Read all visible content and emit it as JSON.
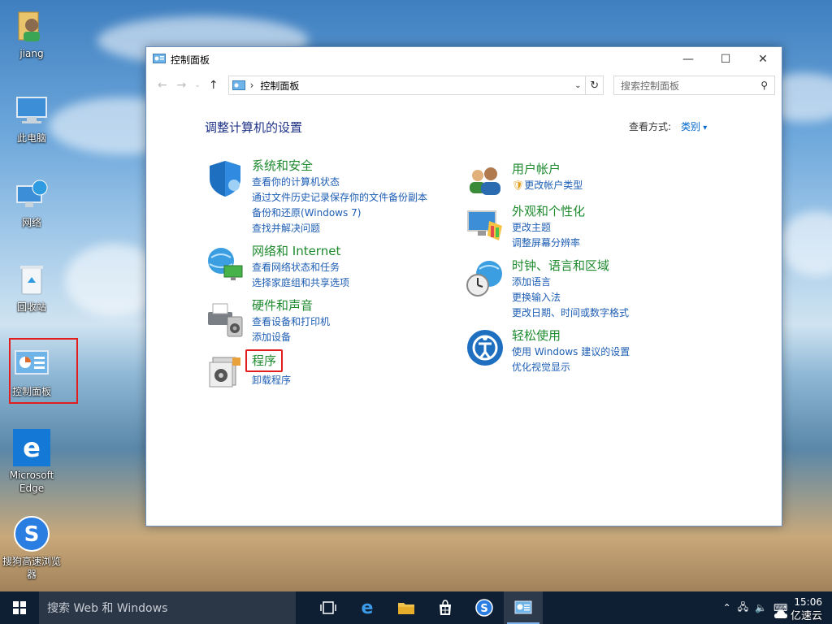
{
  "desktop": {
    "icons": [
      {
        "label": "jiang"
      },
      {
        "label": "此电脑"
      },
      {
        "label": "网络"
      },
      {
        "label": "回收站"
      },
      {
        "label": "控制面板"
      },
      {
        "label": "Microsoft Edge"
      },
      {
        "label": "搜狗高速浏览器"
      }
    ]
  },
  "window": {
    "title": "控制面板",
    "address": {
      "crumb": "控制面板",
      "separator": "›"
    },
    "search_placeholder": "搜索控制面板",
    "heading": "调整计算机的设置",
    "view_by_label": "查看方式:",
    "view_by_value": "类别",
    "categories_left": [
      {
        "title": "系统和安全",
        "links": [
          "查看你的计算机状态",
          "通过文件历史记录保存你的文件备份副本",
          "备份和还原(Windows 7)",
          "查找并解决问题"
        ]
      },
      {
        "title": "网络和 Internet",
        "links": [
          "查看网络状态和任务",
          "选择家庭组和共享选项"
        ]
      },
      {
        "title": "硬件和声音",
        "links": [
          "查看设备和打印机",
          "添加设备"
        ]
      },
      {
        "title": "程序",
        "links": [
          "卸载程序"
        ]
      }
    ],
    "categories_right": [
      {
        "title": "用户帐户",
        "links": [
          "更改帐户类型"
        ]
      },
      {
        "title": "外观和个性化",
        "links": [
          "更改主题",
          "调整屏幕分辨率"
        ]
      },
      {
        "title": "时钟、语言和区域",
        "links": [
          "添加语言",
          "更换输入法",
          "更改日期、时间或数字格式"
        ]
      },
      {
        "title": "轻松使用",
        "links": [
          "使用 Windows 建议的设置",
          "优化视觉显示"
        ]
      }
    ]
  },
  "taskbar": {
    "search_placeholder": "搜索 Web 和 Windows",
    "time": "15:06",
    "watermark": "亿速云"
  },
  "colors": {
    "link": "#1e5eb4",
    "category_title": "#1e8a2e",
    "heading": "#1e3287",
    "highlight": "#e21d1d",
    "taskbar": "#0f1f33"
  }
}
